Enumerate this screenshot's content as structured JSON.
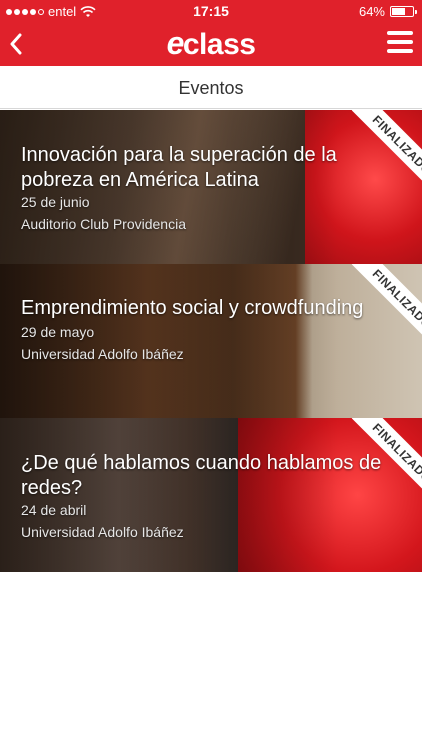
{
  "status_bar": {
    "carrier": "entel",
    "time": "17:15",
    "battery": "64%",
    "battery_level": 0.64
  },
  "header": {
    "logo_mark": "e",
    "logo_text": "class",
    "back_icon": "chevron-left-icon",
    "menu_icon": "hamburger-icon"
  },
  "section": {
    "title": "Eventos"
  },
  "events": [
    {
      "title": "Innovación para la superación de la pobreza en América Latina",
      "date": "25 de junio",
      "venue": "Auditorio Club Providencia",
      "badge": "FINALIZADO"
    },
    {
      "title": "Emprendimiento social y crowdfunding",
      "date": "29 de mayo",
      "venue": "Universidad Adolfo Ibáñez",
      "badge": "FINALIZADO"
    },
    {
      "title": "¿De qué hablamos cuando hablamos de redes?",
      "date": "24 de abril",
      "venue": "Universidad Adolfo Ibáñez",
      "badge": "FINALIZADO"
    }
  ],
  "colors": {
    "brand": "#e0212b"
  }
}
